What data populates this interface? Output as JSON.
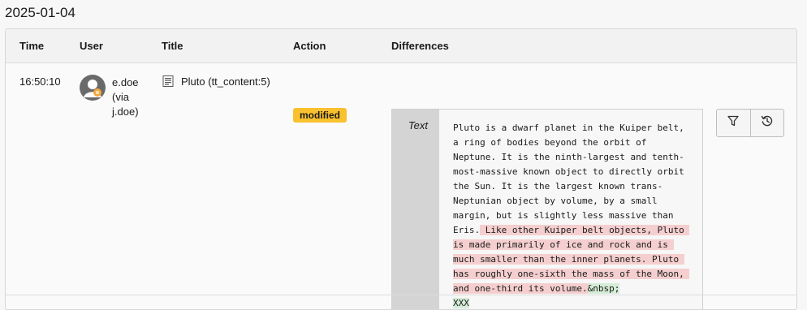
{
  "date_heading": "2025-01-04",
  "columns": {
    "time": "Time",
    "user": "User",
    "title": "Title",
    "action": "Action",
    "differences": "Differences"
  },
  "entry": {
    "time": "16:50:10",
    "user": "e.doe (via j.doe)",
    "title": "Pluto (tt_content:5)",
    "action": "modified",
    "diff_field": "Text",
    "diff_unchanged": "Pluto is a dwarf planet in the Kuiper belt, a ring of bodies beyond the orbit of Neptune. It is the ninth-largest and tenth-most-massive known object to directly orbit the Sun. It is the largest known trans-Neptunian object by volume, by a small margin, but is slightly less massive than Eris.",
    "diff_deleted": " Like other Kuiper belt objects, Pluto is made primarily of ice and rock and is much smaller than the inner planets. Pluto has roughly one-sixth the mass of the Moon, and one-third its volume.",
    "diff_inserted": "&nbsp;\nXXX"
  },
  "icons": {
    "avatar": "user-avatar-icon",
    "record": "content-record-icon",
    "filter": "filter-icon",
    "history": "history-revert-icon"
  },
  "colors": {
    "badge": "#f9c12d",
    "deleted": "#f5cfcf",
    "inserted": "#d5ecd6"
  }
}
